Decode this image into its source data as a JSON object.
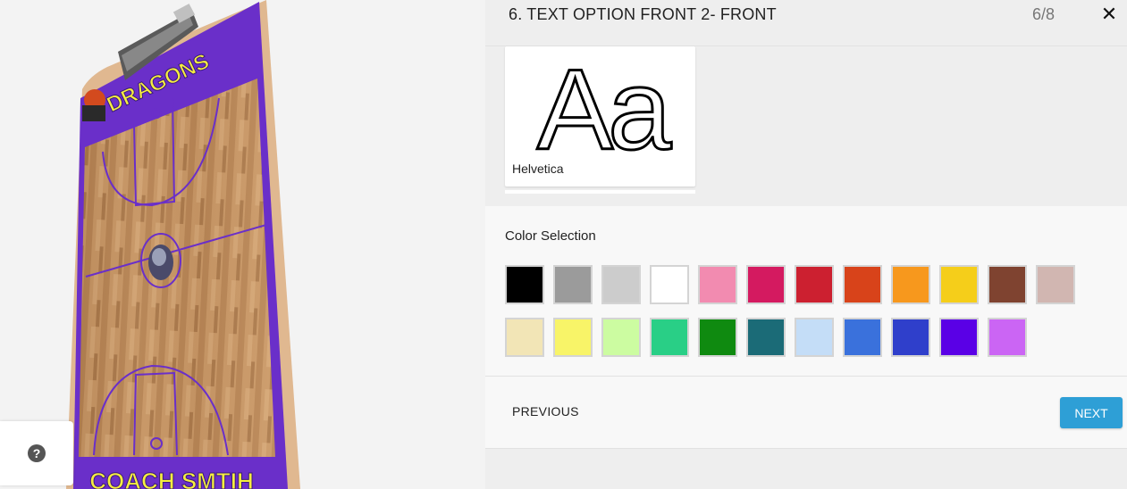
{
  "preview": {
    "team_name": "DRAGONS",
    "coach_name": "COACH SMTIH",
    "help_glyph": "?"
  },
  "header": {
    "title": "6. TEXT OPTION FRONT 2- FRONT",
    "step": "6/8",
    "close_glyph": "✕"
  },
  "font_options": [
    {
      "sample": "Aa",
      "name": "Helvetica",
      "selected": true
    }
  ],
  "color_section": {
    "label": "Color Selection",
    "swatches": [
      "#000000",
      "#9b9b9b",
      "#cccccc",
      "#ffffff",
      "#f28bb0",
      "#d41a60",
      "#cc2030",
      "#d8431a",
      "#f7981d",
      "#f5ce1a",
      "#7f4330",
      "#d1b6b1",
      "#f2e5b6",
      "#f8f468",
      "#ccfca1",
      "#29cf86",
      "#0f8a10",
      "#1b6b77",
      "#c4ddf7",
      "#3a71dc",
      "#2f3fcb",
      "#5a00e6",
      "#cb65f4"
    ]
  },
  "nav": {
    "previous_label": "PREVIOUS",
    "next_label": "NEXT"
  }
}
